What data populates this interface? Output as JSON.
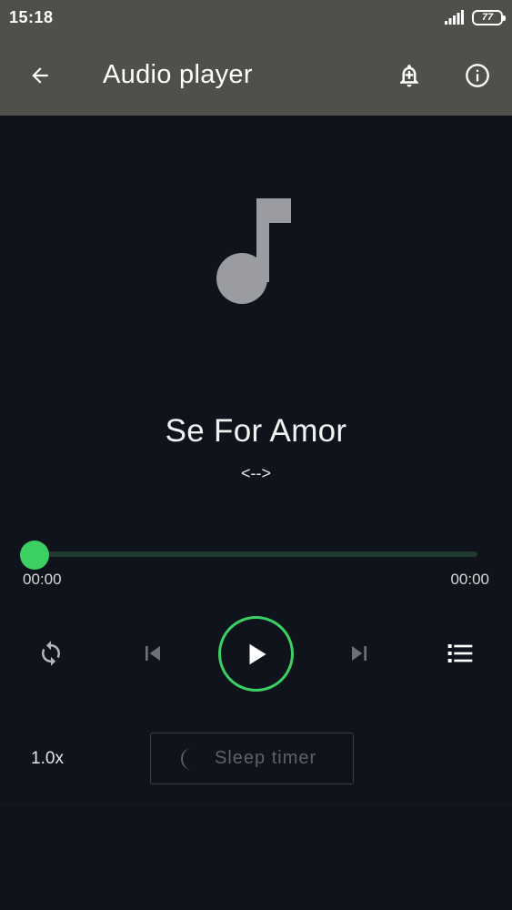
{
  "status_bar": {
    "time": "15:18",
    "battery_level": "77",
    "icons": [
      "signal-icon",
      "battery-icon"
    ]
  },
  "toolbar": {
    "title": "Audio player",
    "icons": [
      "back-arrow-icon",
      "alarm-add-icon",
      "info-icon"
    ]
  },
  "artwork": {
    "icon": "music-note-icon",
    "color": "#9a9ca1"
  },
  "track": {
    "title": "Se For Amor",
    "artist": "<-->"
  },
  "progress": {
    "current_time": "00:00",
    "total_time": "00:00",
    "fraction": 0
  },
  "controls": {
    "icons": [
      "repeat-icon",
      "skip-previous-icon",
      "play-icon",
      "skip-next-icon",
      "playlist-icon"
    ],
    "accent_color": "#3ccf63"
  },
  "speed": {
    "label": "1.0x"
  },
  "sleep_timer": {
    "label": "Sleep timer",
    "icon": "moon-icon"
  }
}
